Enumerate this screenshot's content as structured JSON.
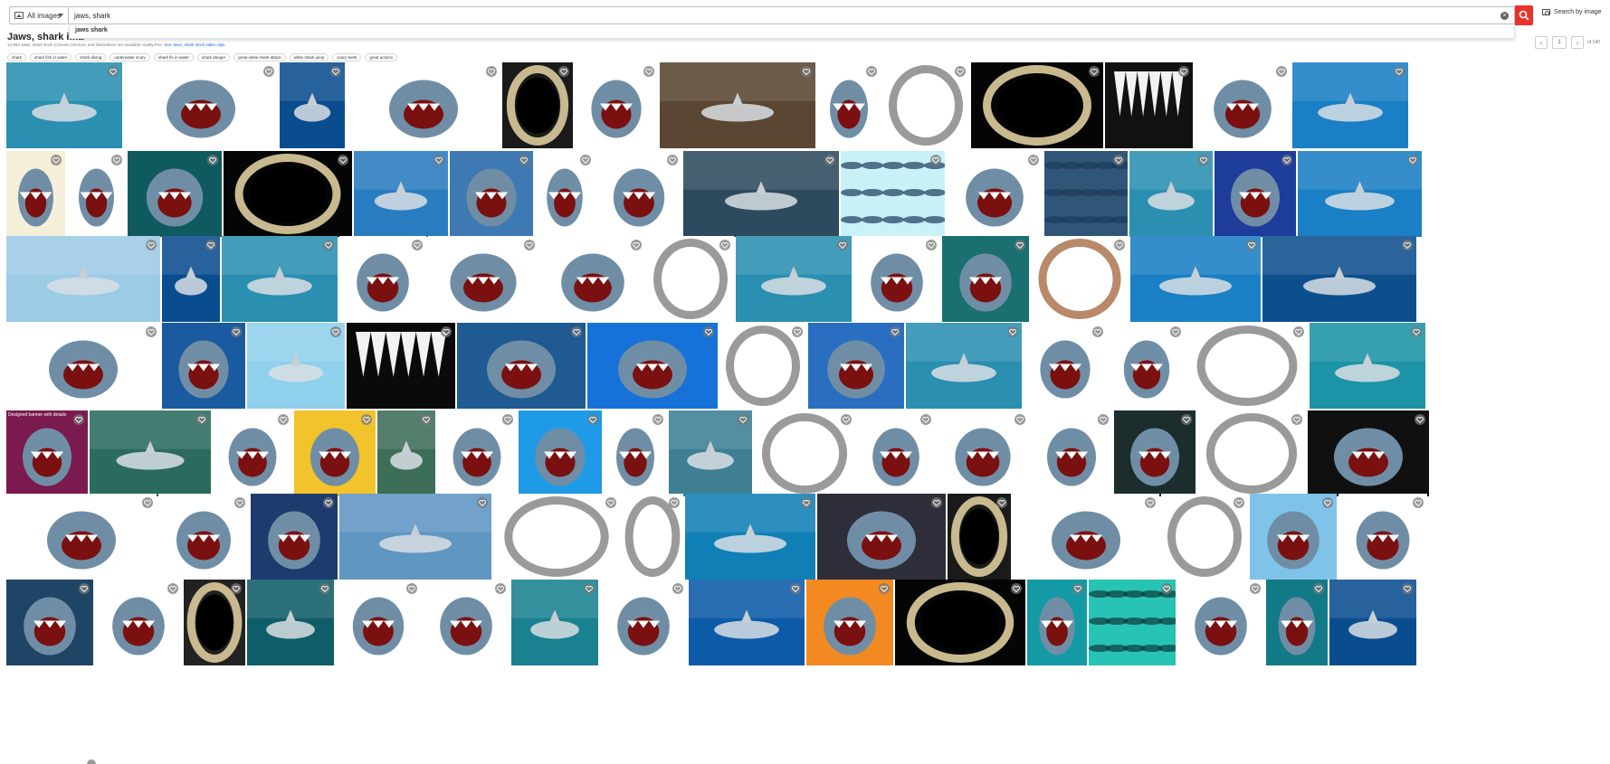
{
  "search": {
    "filter_label": "All images",
    "query": "jaws, shark",
    "suggestion": "jaws shark",
    "by_image_label": "Search by image"
  },
  "heading": {
    "title": "Jaws, shark ima",
    "subtitle_text": "13,963 Jaws, shark stock (Choose (Vectors, and illustrations are available royalty-free.",
    "subtitle_link": "See Jaws, shark stock video clips"
  },
  "pagination": {
    "current": "1",
    "of_label": "of 140"
  },
  "chips": [
    "shark",
    "shark fish in water",
    "shark diving",
    "underwater scary",
    "shark fin in water",
    "shark danger",
    "great white shark attack",
    "white shark jump",
    "scary teeth",
    "great actions"
  ],
  "tile_label_banner": "Designed banner with details",
  "colors": {
    "accent": "#e8332c",
    "link": "#1a66c7"
  },
  "rows": [
    [
      {
        "w": 128,
        "t": "ocean"
      },
      {
        "w": 170,
        "t": "shark-white"
      },
      {
        "w": 72,
        "t": "deep"
      },
      {
        "w": 170,
        "t": "shark-white"
      },
      {
        "w": 78,
        "t": "jaw-black"
      },
      {
        "w": 92,
        "t": "cartoon"
      },
      {
        "w": 172,
        "t": "photo-brown"
      },
      {
        "w": 70,
        "t": "logo-red"
      },
      {
        "w": 96,
        "t": "jaw-white"
      },
      {
        "w": 146,
        "t": "jaw-bone-black"
      },
      {
        "w": 97,
        "t": "teeth-bw"
      },
      {
        "w": 106,
        "t": "shark-white"
      },
      {
        "w": 128,
        "t": "ocean-bright"
      }
    ],
    [
      {
        "w": 65,
        "t": "cartoon-cream"
      },
      {
        "w": 65,
        "t": "silhouette-white"
      },
      {
        "w": 104,
        "t": "teal-icon"
      },
      {
        "w": 142,
        "t": "jaw-bone-black"
      },
      {
        "w": 104,
        "t": "fin-sea"
      },
      {
        "w": 92,
        "t": "cartoon-blue"
      },
      {
        "w": 66,
        "t": "shark-white"
      },
      {
        "w": 94,
        "t": "logo-teal"
      },
      {
        "w": 172,
        "t": "breach"
      },
      {
        "w": 115,
        "t": "pattern-cyan"
      },
      {
        "w": 106,
        "t": "shark-white"
      },
      {
        "w": 92,
        "t": "pattern-dark"
      },
      {
        "w": 92,
        "t": "ocean"
      },
      {
        "w": 90,
        "t": "cartoon-navy"
      },
      {
        "w": 137,
        "t": "ocean-bright"
      }
    ],
    [
      {
        "w": 170,
        "t": "breach-white"
      },
      {
        "w": 64,
        "t": "deep"
      },
      {
        "w": 128,
        "t": "ocean"
      },
      {
        "w": 96,
        "t": "shark-white"
      },
      {
        "w": 122,
        "t": "icon-navy"
      },
      {
        "w": 116,
        "t": "sketch"
      },
      {
        "w": 96,
        "t": "jaw-white"
      },
      {
        "w": 128,
        "t": "ocean"
      },
      {
        "w": 96,
        "t": "cartoon"
      },
      {
        "w": 96,
        "t": "badge-attack"
      },
      {
        "w": 108,
        "t": "jaw-brown"
      },
      {
        "w": 144,
        "t": "ocean-bright"
      },
      {
        "w": 170,
        "t": "ocean-deep"
      }
    ],
    [
      {
        "w": 170,
        "t": "shark-white"
      },
      {
        "w": 92,
        "t": "blood"
      },
      {
        "w": 108,
        "t": "ocean-light"
      },
      {
        "w": 120,
        "t": "teeth-grid"
      },
      {
        "w": 142,
        "t": "week"
      },
      {
        "w": 144,
        "t": "whiteshark"
      },
      {
        "w": 96,
        "t": "jaw-white"
      },
      {
        "w": 106,
        "t": "lobster"
      },
      {
        "w": 128,
        "t": "ocean"
      },
      {
        "w": 92,
        "t": "cartoon"
      },
      {
        "w": 84,
        "t": "cartoon-glasses"
      },
      {
        "w": 134,
        "t": "jaw-rings"
      },
      {
        "w": 128,
        "t": "ocean-teal"
      }
    ],
    [
      {
        "w": 90,
        "t": "danger-pink"
      },
      {
        "w": 134,
        "t": "photo-green"
      },
      {
        "w": 88,
        "t": "sign-yellow"
      },
      {
        "w": 90,
        "t": "popart"
      },
      {
        "w": 64,
        "t": "photo-dark"
      },
      {
        "w": 88,
        "t": "icon-navy-2"
      },
      {
        "w": 92,
        "t": "cartoon-blue-2"
      },
      {
        "w": 70,
        "t": "totally"
      },
      {
        "w": 92,
        "t": "fins"
      },
      {
        "w": 112,
        "t": "jaw-white"
      },
      {
        "w": 86,
        "t": "shark-sketch"
      },
      {
        "w": 102,
        "t": "shark-blue"
      },
      {
        "w": 90,
        "t": "danger-text"
      },
      {
        "w": 90,
        "t": "logo-dark"
      },
      {
        "w": 120,
        "t": "jaw-white"
      },
      {
        "w": 134,
        "t": "cartoon-dark"
      }
    ],
    [
      {
        "w": 166,
        "t": "shark-white"
      },
      {
        "w": 100,
        "t": "shark-white"
      },
      {
        "w": 96,
        "t": "badge-attack-2"
      },
      {
        "w": 168,
        "t": "breach-sea"
      },
      {
        "w": 140,
        "t": "jaw-white"
      },
      {
        "w": 68,
        "t": "jaw-white-2"
      },
      {
        "w": 144,
        "t": "ocean-hammer"
      },
      {
        "w": 142,
        "t": "movie"
      },
      {
        "w": 70,
        "t": "jaw-black"
      },
      {
        "w": 162,
        "t": "shark-closeup"
      },
      {
        "w": 96,
        "t": "jaw-white"
      },
      {
        "w": 96,
        "t": "boat"
      },
      {
        "w": 98,
        "t": "cartoon-wave"
      }
    ],
    [
      {
        "w": 96,
        "t": "icon-navy-3"
      },
      {
        "w": 96,
        "t": "mouth"
      },
      {
        "w": 68,
        "t": "jaw-dark"
      },
      {
        "w": 96,
        "t": "photo-teal"
      },
      {
        "w": 94,
        "t": "cartoon-fierce"
      },
      {
        "w": 96,
        "t": "shark-icon-teal"
      },
      {
        "w": 96,
        "t": "ocean-diver"
      },
      {
        "w": 96,
        "t": "area-badge"
      },
      {
        "w": 128,
        "t": "ocean-blue"
      },
      {
        "w": 96,
        "t": "cartoon-orange"
      },
      {
        "w": 144,
        "t": "jaw-bone-black"
      },
      {
        "w": 66,
        "t": "cartoon-teal"
      },
      {
        "w": 96,
        "t": "pattern-fins"
      },
      {
        "w": 96,
        "t": "shark-white"
      },
      {
        "w": 68,
        "t": "shark-icon-teal-2"
      },
      {
        "w": 96,
        "t": "deep"
      }
    ]
  ]
}
